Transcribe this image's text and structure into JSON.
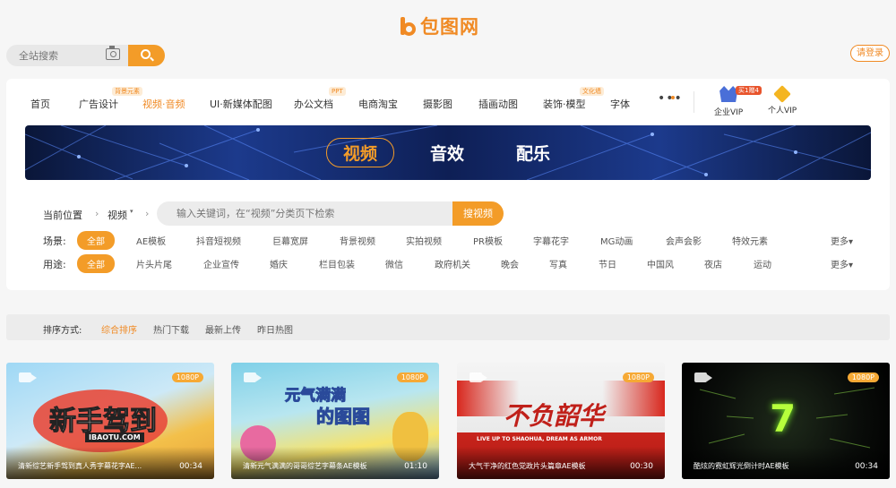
{
  "site": {
    "logo_text": "包图网",
    "login_label": "请登录"
  },
  "search": {
    "placeholder": "全站搜索"
  },
  "nav": {
    "items": [
      "首页",
      "广告设计",
      "视频·音频",
      "UI·新媒体配图",
      "办公文档",
      "电商淘宝",
      "摄影图",
      "插画动图",
      "装饰·模型",
      "字体"
    ],
    "tags": {
      "ad": "背景元素",
      "office": "PPT",
      "decor": "文化墙"
    },
    "more": "•••",
    "vip": {
      "enterprise_label": "企业VIP",
      "enterprise_badge": "买1赠4",
      "personal_label": "个人VIP"
    }
  },
  "banner": {
    "tabs": [
      "视频",
      "音效",
      "配乐"
    ]
  },
  "crumb": {
    "label": "当前位置",
    "current": "视频",
    "caret": "▾"
  },
  "cat_search": {
    "placeholder": "输入关键词，在“视频”分类页下检索",
    "button": "搜视频"
  },
  "filters": {
    "scene": {
      "label": "场景:",
      "items": [
        "全部",
        "AE模板",
        "抖音短视频",
        "巨幕宽屏",
        "背景视频",
        "实拍视频",
        "PR模板",
        "字幕花字",
        "MG动画",
        "会声会影",
        "特效元素"
      ],
      "more": "更多▾"
    },
    "usage": {
      "label": "用途:",
      "items": [
        "全部",
        "片头片尾",
        "企业宣传",
        "婚庆",
        "栏目包装",
        "微信",
        "政府机关",
        "晚会",
        "写真",
        "节日",
        "中国风",
        "夜店",
        "运动"
      ],
      "more": "更多▾"
    }
  },
  "sort": {
    "label": "排序方式:",
    "items": [
      "综合排序",
      "热门下载",
      "最新上传",
      "昨日热图"
    ]
  },
  "videos": [
    {
      "resolution": "1080P",
      "title": "清新综艺新手驾到真人秀字幕花字AE...",
      "duration": "00:34",
      "art_text": "新手驾到",
      "art_sub": "IBAOTU.COM"
    },
    {
      "resolution": "1080P",
      "title": "清新元气满满的哥哥综艺字幕条AE模板",
      "duration": "01:10",
      "art_text": "元气满满",
      "art_sub": "的图图"
    },
    {
      "resolution": "1080P",
      "title": "大气干净的红色党政片头篇章AE模板",
      "duration": "00:30",
      "art_text": "不负韶华",
      "art_sub": "LIVE UP TO SHAOHUA, DREAM AS ARMOR"
    },
    {
      "resolution": "1080P",
      "title": "酷炫的霓虹辉光倒计时AE模板",
      "duration": "00:34",
      "art_text": "7",
      "art_sub": ""
    }
  ],
  "colors": {
    "accent": "#f39c28",
    "brand": "#f08a24"
  }
}
